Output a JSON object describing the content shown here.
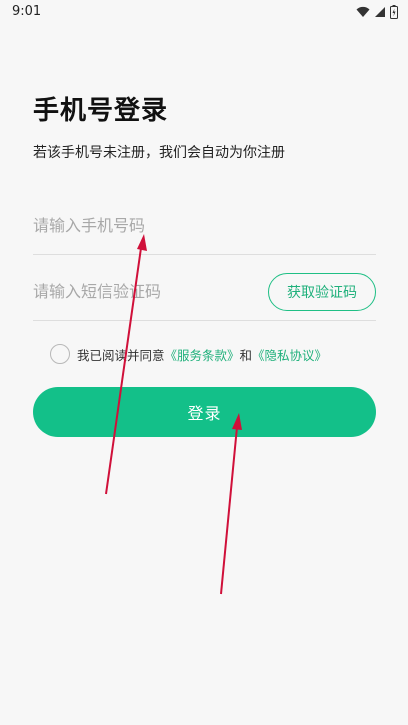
{
  "status_bar": {
    "time": "9:01",
    "icons": [
      "wifi-icon",
      "signal-icon",
      "battery-charging-icon"
    ]
  },
  "header": {
    "title": "手机号登录",
    "subtitle": "若该手机号未注册，我们会自动为你注册"
  },
  "form": {
    "phone_placeholder": "请输入手机号码",
    "phone_value": "",
    "code_placeholder": "请输入短信验证码",
    "code_value": "",
    "get_code_label": "获取验证码"
  },
  "agreement": {
    "prefix": "我已阅读并同意",
    "terms_link": "《服务条款》",
    "and": "和",
    "privacy_link": "《隐私协议》",
    "checked": false
  },
  "login_button_label": "登录",
  "colors": {
    "accent": "#13c089",
    "link": "#1fb07b",
    "annotation_arrow": "#d0103a"
  }
}
